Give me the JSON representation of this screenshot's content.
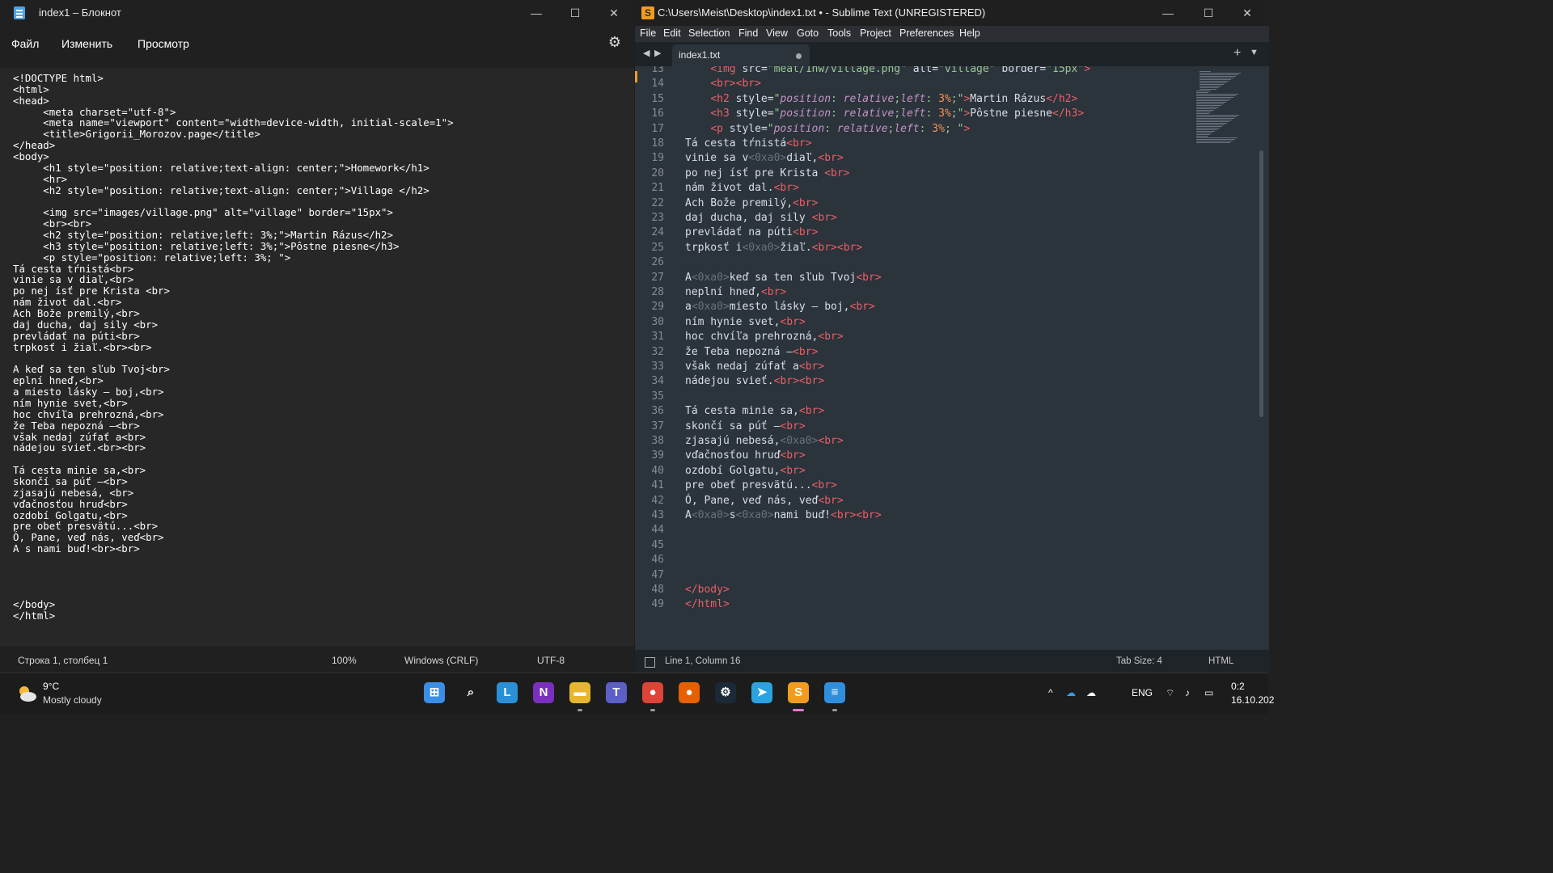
{
  "notepad": {
    "title": "index1 – Блокнот",
    "menu": [
      "Файл",
      "Изменить",
      "Просмотр"
    ],
    "controls": {
      "minimize": "—",
      "maximize": "☐",
      "close": "✕"
    },
    "content": "<!DOCTYPE html>\n<html>\n<head>\n     <meta charset=\"utf-8\">\n     <meta name=\"viewport\" content=\"width=device-width, initial-scale=1\">\n     <title>Grigorii_Morozov.page</title>\n</head>\n<body>\n     <h1 style=\"position: relative;text-align: center;\">Homework</h1>\n     <hr>\n     <h2 style=\"position: relative;text-align: center;\">Village </h2>\n\n     <img src=\"images/village.png\" alt=\"village\" border=\"15px\">\n     <br><br>\n     <h2 style=\"position: relative;left: 3%;\">Martin Rázus</h2>\n     <h3 style=\"position: relative;left: 3%;\">Pôstne piesne</h3>\n     <p style=\"position: relative;left: 3%; \">\nTá cesta tŕnistá<br>\nvinie sa v diaľ,<br>\npo nej ísť pre Krista <br>\nnám život dal.<br>\nAch Bože premilý,<br>\ndaj ducha, daj sily <br>\nprevládať na púti<br>\ntrpkosť i žiaľ.<br><br>\n\nA keď sa ten sľub Tvoj<br>\neplní hneď,<br>\na miesto lásky – boj,<br>\nním hynie svet,<br>\nhoc chvíľa prehrozná,<br>\nže Teba nepozná –<br>\nvšak nedaj zúfať a<br>\nnádejou svieť.<br><br>\n\nTá cesta minie sa,<br>\nskončí sa púť –<br>\nzjasajú nebesá, <br>\nvďačnosťou hruď<br>\nozdobí Golgatu,<br>\npre obeť presvätú...<br>\nÓ, Pane, veď nás, veď<br>\nA s nami buď!<br><br>\n\n\n\n\n</body>\n</html>",
    "status": {
      "position": "Строка 1, столбец 1",
      "zoom": "100%",
      "line_endings": "Windows (CRLF)",
      "encoding": "UTF-8"
    }
  },
  "sublime": {
    "title": "C:\\Users\\Meist\\Desktop\\index1.txt • - Sublime Text (UNREGISTERED)",
    "logo": "S",
    "menu": [
      "File",
      "Edit",
      "Selection",
      "Find",
      "View",
      "Goto",
      "Tools",
      "Project",
      "Preferences",
      "Help"
    ],
    "tab": {
      "label": "index1.txt",
      "modified": true
    },
    "controls": {
      "minimize": "—",
      "maximize": "☐",
      "close": "✕"
    },
    "nav": {
      "back": "◀",
      "forward": "▶",
      "new_tab": "+",
      "tab_list": "▼"
    },
    "line_numbers": [
      "13",
      "14",
      "15",
      "16",
      "17",
      "18",
      "19",
      "20",
      "21",
      "22",
      "23",
      "24",
      "25",
      "26",
      "27",
      "28",
      "29",
      "30",
      "31",
      "32",
      "33",
      "34",
      "35",
      "36",
      "37",
      "38",
      "39",
      "40",
      "41",
      "42",
      "43",
      "44",
      "45",
      "46",
      "47",
      "48",
      "49"
    ],
    "lines": [
      "    <img src=\"meat/1hw/village.png\" alt=\"village\" border=\"15px\">",
      "    <br><br>",
      "    <h2 style=\"position: relative;left: 3%;\">Martin Rázus</h2>",
      "    <h3 style=\"position: relative;left: 3%;\">Pôstne piesne</h3>",
      "    <p style=\"position: relative;left: 3%; \">",
      "Tá cesta tŕnistá<br>",
      "vinie sa v<0xa0>diaľ,<br>",
      "po nej ísť pre Krista <br>",
      "nám život dal.<br>",
      "Ach Bože premilý,<br>",
      "daj ducha, daj sily <br>",
      "prevládať na púti<br>",
      "trpkosť i<0xa0>žiaľ.<br><br>",
      "",
      "A<0xa0>keď sa ten sľub Tvoj<br>",
      "neplní hneď,<br>",
      "a<0xa0>miesto lásky – boj,<br>",
      "ním hynie svet,<br>",
      "hoc chvíľa prehrozná,<br>",
      "že Teba nepozná –<br>",
      "však nedaj zúfať a<br>",
      "nádejou svieť.<br><br>",
      "",
      "Tá cesta minie sa,<br>",
      "skončí sa púť –<br>",
      "zjasajú nebesá,<0xa0><br>",
      "vďačnosťou hruď<br>",
      "ozdobí Golgatu,<br>",
      "pre obeť presvätú...<br>",
      "Ó, Pane, veď nás, veď<br>",
      "A<0xa0>s<0xa0>nami buď!<br><br>",
      "",
      "",
      "",
      "",
      "</body>",
      "</html>"
    ],
    "status": {
      "position": "Line 1, Column 16",
      "tab_size": "Tab Size: 4",
      "syntax": "HTML"
    },
    "colors": {
      "bg": "#2b333b",
      "tag": "#ec5f67",
      "string": "#99c794",
      "keyword": "#c594c5",
      "number": "#f99157",
      "text": "#d8dee9",
      "hex_escape": "#65737e"
    }
  },
  "taskbar": {
    "weather": {
      "temp": "9°C",
      "desc": "Mostly cloudy",
      "icon": "cloud-sun-icon"
    },
    "apps": [
      {
        "name": "windows-start-icon",
        "glyph": "⊞",
        "color": "#3a8ee6"
      },
      {
        "name": "search-icon",
        "glyph": "⌕",
        "color": "#1c1c1c"
      },
      {
        "name": "lingq-icon",
        "glyph": "L",
        "color": "#2b8fd6"
      },
      {
        "name": "onenote-icon",
        "glyph": "N",
        "color": "#7b2fbf"
      },
      {
        "name": "file-explorer-icon",
        "glyph": "▬",
        "color": "#e8b52f"
      },
      {
        "name": "teams-icon",
        "glyph": "T",
        "color": "#5b5fc7"
      },
      {
        "name": "chrome-icon",
        "glyph": "●",
        "color": "#db4437"
      },
      {
        "name": "firefox-icon",
        "glyph": "●",
        "color": "#e66000"
      },
      {
        "name": "steam-icon",
        "glyph": "⚙",
        "color": "#1b2838"
      },
      {
        "name": "telegram-icon",
        "glyph": "➤",
        "color": "#2aa3e0"
      },
      {
        "name": "sublime-icon",
        "glyph": "S",
        "color": "#f29c1f"
      },
      {
        "name": "notepad-icon",
        "glyph": "≡",
        "color": "#2f8fdd"
      }
    ],
    "tray": {
      "chevron": "^",
      "lang": "ENG",
      "time": "0:2",
      "date": "16.10.202"
    }
  }
}
